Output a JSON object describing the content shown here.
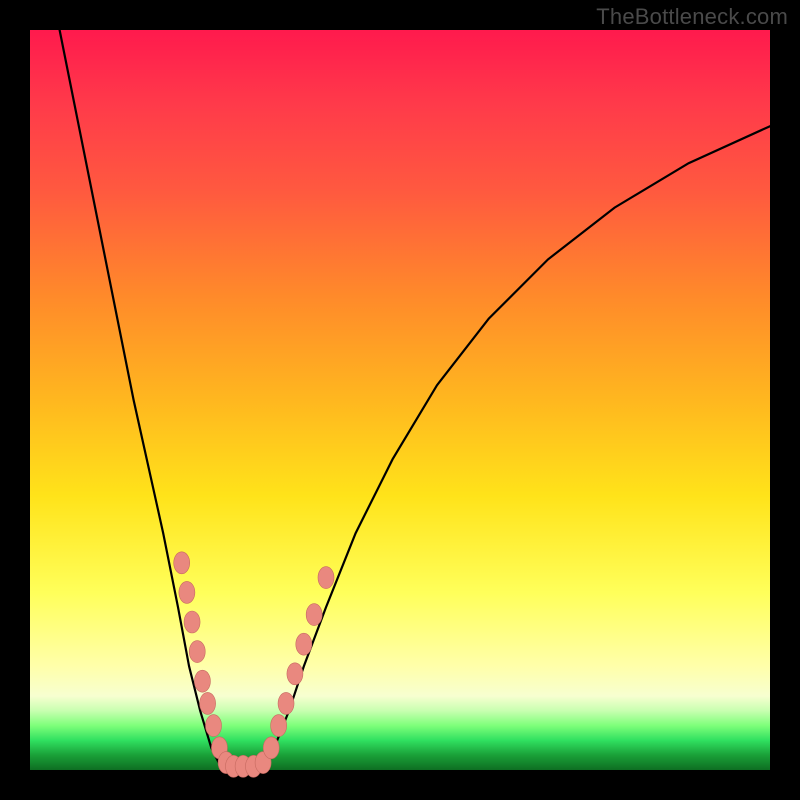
{
  "watermark": "TheBottleneck.com",
  "chart_data": {
    "type": "line",
    "title": "",
    "xlabel": "",
    "ylabel": "",
    "xlim": [
      0,
      100
    ],
    "ylim": [
      0,
      100
    ],
    "grid": false,
    "legend": false,
    "series": [
      {
        "name": "left-curve",
        "x": [
          4,
          6,
          8,
          10,
          12,
          14,
          16,
          18,
          20,
          21.5,
          23,
          24.5,
          25.5,
          26.5
        ],
        "y": [
          100,
          90,
          80,
          70,
          60,
          50,
          41,
          32,
          22,
          14,
          8,
          3,
          1,
          0
        ]
      },
      {
        "name": "bottom-flat",
        "x": [
          26.5,
          28,
          30,
          31.5
        ],
        "y": [
          0,
          0,
          0,
          0
        ]
      },
      {
        "name": "right-curve",
        "x": [
          31.5,
          33,
          35,
          37,
          40,
          44,
          49,
          55,
          62,
          70,
          79,
          89,
          100
        ],
        "y": [
          0,
          3,
          8,
          14,
          22,
          32,
          42,
          52,
          61,
          69,
          76,
          82,
          87
        ]
      }
    ],
    "beads": [
      {
        "x": 20.5,
        "y": 28
      },
      {
        "x": 21.2,
        "y": 24
      },
      {
        "x": 21.9,
        "y": 20
      },
      {
        "x": 22.6,
        "y": 16
      },
      {
        "x": 23.3,
        "y": 12
      },
      {
        "x": 24.0,
        "y": 9
      },
      {
        "x": 24.8,
        "y": 6
      },
      {
        "x": 25.6,
        "y": 3
      },
      {
        "x": 26.5,
        "y": 1
      },
      {
        "x": 27.5,
        "y": 0.5
      },
      {
        "x": 28.8,
        "y": 0.5
      },
      {
        "x": 30.2,
        "y": 0.5
      },
      {
        "x": 31.5,
        "y": 1
      },
      {
        "x": 32.6,
        "y": 3
      },
      {
        "x": 33.6,
        "y": 6
      },
      {
        "x": 34.6,
        "y": 9
      },
      {
        "x": 35.8,
        "y": 13
      },
      {
        "x": 37.0,
        "y": 17
      },
      {
        "x": 38.4,
        "y": 21
      },
      {
        "x": 40.0,
        "y": 26
      }
    ],
    "bead_color": "#e9887f"
  }
}
